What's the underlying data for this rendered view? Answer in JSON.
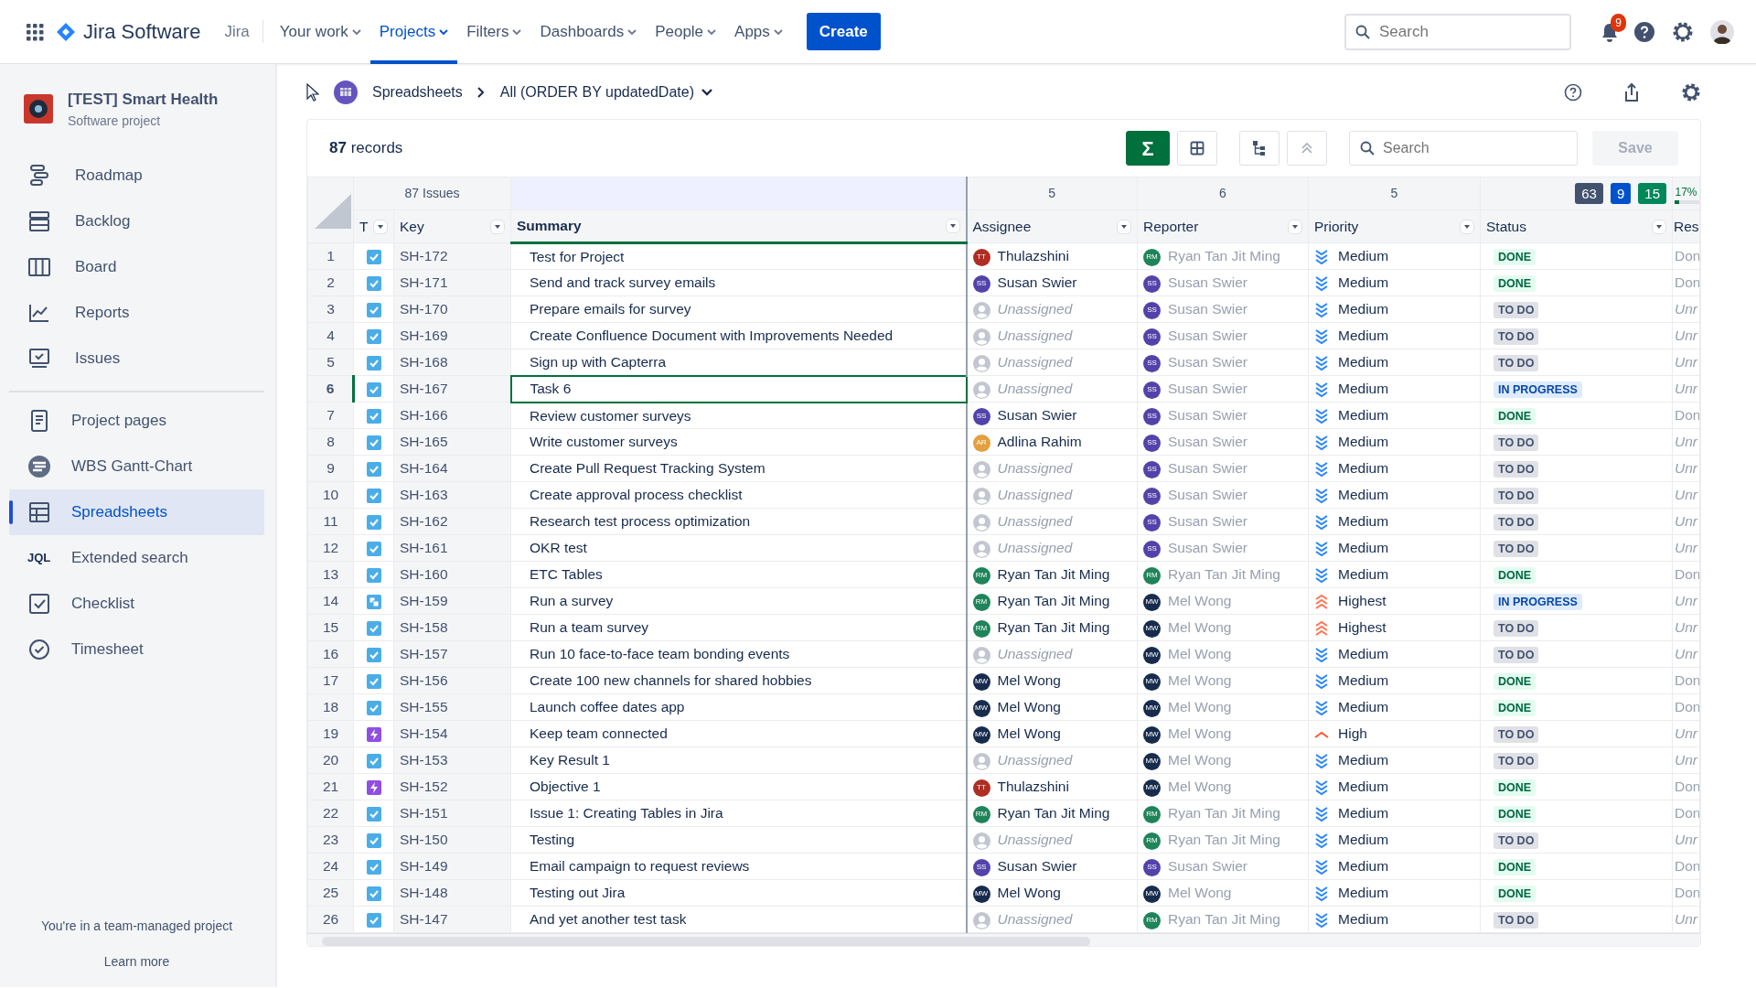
{
  "topnav": {
    "product": "Jira Software",
    "site": "Jira",
    "menus": [
      {
        "label": "Your work",
        "selected": false
      },
      {
        "label": "Projects",
        "selected": true
      },
      {
        "label": "Filters",
        "selected": false
      },
      {
        "label": "Dashboards",
        "selected": false
      },
      {
        "label": "People",
        "selected": false
      },
      {
        "label": "Apps",
        "selected": false
      }
    ],
    "create": "Create",
    "search_placeholder": "Search",
    "notifications": "9"
  },
  "sidebar": {
    "project": "[TEST] Smart Health",
    "project_type": "Software project",
    "planning_items": [
      {
        "label": "Roadmap",
        "kind": "roadmap",
        "selected": false
      },
      {
        "label": "Backlog",
        "kind": "backlog",
        "selected": false
      },
      {
        "label": "Board",
        "kind": "board",
        "selected": false
      },
      {
        "label": "Reports",
        "kind": "reports",
        "selected": false
      },
      {
        "label": "Issues",
        "kind": "issues",
        "selected": false
      }
    ],
    "app_items": [
      {
        "label": "Project pages",
        "kind": "pages",
        "selected": false
      },
      {
        "label": "WBS Gantt-Chart",
        "kind": "gantt",
        "selected": false
      },
      {
        "label": "Spreadsheets",
        "kind": "sheet",
        "selected": true
      },
      {
        "label": "Extended search",
        "kind": "jql",
        "glyph": "JQL",
        "selected": false
      },
      {
        "label": "Checklist",
        "kind": "checklist",
        "selected": false
      },
      {
        "label": "Timesheet",
        "kind": "timesheet",
        "selected": false
      }
    ],
    "footer": "You're in a team-managed project",
    "footer_link": "Learn more"
  },
  "breadcrumb": {
    "parent": "Spreadsheets",
    "view": "All (ORDER BY updatedDate)"
  },
  "sheet": {
    "records_count": "87",
    "records_label": "records",
    "sum_button": "Σ",
    "search_placeholder": "Search",
    "save": "Save",
    "summary_row": {
      "issues": "87 Issues",
      "assignee": "5",
      "reporter": "6",
      "priority": "5",
      "status_counts": [
        {
          "count": "63",
          "color": "#42526e"
        },
        {
          "count": "9",
          "color": "#0052cc"
        },
        {
          "count": "15",
          "color": "#00875a"
        }
      ],
      "progress": {
        "reading": "17%",
        "level": 0.17
      }
    },
    "columns": [
      "T",
      "Key",
      "Summary",
      "Assignee",
      "Reporter",
      "Priority",
      "Status",
      "Res"
    ],
    "rows": [
      {
        "n": "1",
        "kind": "task",
        "key": "SH-172",
        "summary": "Test for Project",
        "assignee": {
          "kind": "user",
          "name": "Thulazshini",
          "initials": "TT",
          "color": "#ae2e24"
        },
        "reporter": {
          "kind": "user",
          "name": "Ryan Tan Jit Ming",
          "initials": "RM",
          "color": "#1f845a"
        },
        "priority": {
          "label": "Medium",
          "kind": "medium"
        },
        "status": {
          "label": "DONE",
          "kind": "done"
        },
        "resolution": "Don",
        "selected": false
      },
      {
        "n": "2",
        "kind": "task",
        "key": "SH-171",
        "summary": "Send and track survey emails",
        "assignee": {
          "kind": "user",
          "name": "Susan Swier",
          "initials": "SS",
          "color": "#5243aa"
        },
        "reporter": {
          "kind": "user",
          "name": "Susan Swier",
          "initials": "SS",
          "color": "#5243aa"
        },
        "priority": {
          "label": "Medium",
          "kind": "medium"
        },
        "status": {
          "label": "DONE",
          "kind": "done"
        },
        "resolution": "Don",
        "selected": false
      },
      {
        "n": "3",
        "kind": "task",
        "key": "SH-170",
        "summary": "Prepare emails for survey",
        "assignee": {
          "kind": "unassigned",
          "name": "Unassigned"
        },
        "reporter": {
          "kind": "user",
          "name": "Susan Swier",
          "initials": "SS",
          "color": "#5243aa"
        },
        "priority": {
          "label": "Medium",
          "kind": "medium"
        },
        "status": {
          "label": "TO DO",
          "kind": "todo"
        },
        "resolution": "Unr",
        "selected": false
      },
      {
        "n": "4",
        "kind": "task",
        "key": "SH-169",
        "summary": "Create Confluence Document with Improvements Needed",
        "assignee": {
          "kind": "unassigned",
          "name": "Unassigned"
        },
        "reporter": {
          "kind": "user",
          "name": "Susan Swier",
          "initials": "SS",
          "color": "#5243aa"
        },
        "priority": {
          "label": "Medium",
          "kind": "medium"
        },
        "status": {
          "label": "TO DO",
          "kind": "todo"
        },
        "resolution": "Unr",
        "selected": false
      },
      {
        "n": "5",
        "kind": "task",
        "key": "SH-168",
        "summary": "Sign up with Capterra",
        "assignee": {
          "kind": "unassigned",
          "name": "Unassigned"
        },
        "reporter": {
          "kind": "user",
          "name": "Susan Swier",
          "initials": "SS",
          "color": "#5243aa"
        },
        "priority": {
          "label": "Medium",
          "kind": "medium"
        },
        "status": {
          "label": "TO DO",
          "kind": "todo"
        },
        "resolution": "Unr",
        "selected": false
      },
      {
        "n": "6",
        "kind": "task",
        "key": "SH-167",
        "summary": "Task 6",
        "assignee": {
          "kind": "unassigned",
          "name": "Unassigned"
        },
        "reporter": {
          "kind": "user",
          "name": "Susan Swier",
          "initials": "SS",
          "color": "#5243aa"
        },
        "priority": {
          "label": "Medium",
          "kind": "medium"
        },
        "status": {
          "label": "IN PROGRESS",
          "kind": "progress"
        },
        "resolution": "Unr",
        "selected": true
      },
      {
        "n": "7",
        "kind": "task",
        "key": "SH-166",
        "summary": "Review customer surveys",
        "assignee": {
          "kind": "user",
          "name": "Susan Swier",
          "initials": "SS",
          "color": "#5243aa"
        },
        "reporter": {
          "kind": "user",
          "name": "Susan Swier",
          "initials": "SS",
          "color": "#5243aa"
        },
        "priority": {
          "label": "Medium",
          "kind": "medium"
        },
        "status": {
          "label": "DONE",
          "kind": "done"
        },
        "resolution": "Don",
        "selected": false
      },
      {
        "n": "8",
        "kind": "task",
        "key": "SH-165",
        "summary": "Write customer surveys",
        "assignee": {
          "kind": "user",
          "name": "Adlina Rahim",
          "initials": "AR",
          "color": "#e2a03f"
        },
        "reporter": {
          "kind": "user",
          "name": "Susan Swier",
          "initials": "SS",
          "color": "#5243aa"
        },
        "priority": {
          "label": "Medium",
          "kind": "medium"
        },
        "status": {
          "label": "TO DO",
          "kind": "todo"
        },
        "resolution": "Unr",
        "selected": false
      },
      {
        "n": "9",
        "kind": "task",
        "key": "SH-164",
        "summary": "Create Pull Request Tracking System",
        "assignee": {
          "kind": "unassigned",
          "name": "Unassigned"
        },
        "reporter": {
          "kind": "user",
          "name": "Susan Swier",
          "initials": "SS",
          "color": "#5243aa"
        },
        "priority": {
          "label": "Medium",
          "kind": "medium"
        },
        "status": {
          "label": "TO DO",
          "kind": "todo"
        },
        "resolution": "Unr",
        "selected": false
      },
      {
        "n": "10",
        "kind": "task",
        "key": "SH-163",
        "summary": "Create approval process checklist",
        "assignee": {
          "kind": "unassigned",
          "name": "Unassigned"
        },
        "reporter": {
          "kind": "user",
          "name": "Susan Swier",
          "initials": "SS",
          "color": "#5243aa"
        },
        "priority": {
          "label": "Medium",
          "kind": "medium"
        },
        "status": {
          "label": "TO DO",
          "kind": "todo"
        },
        "resolution": "Unr",
        "selected": false
      },
      {
        "n": "11",
        "kind": "task",
        "key": "SH-162",
        "summary": "Research test process optimization",
        "assignee": {
          "kind": "unassigned",
          "name": "Unassigned"
        },
        "reporter": {
          "kind": "user",
          "name": "Susan Swier",
          "initials": "SS",
          "color": "#5243aa"
        },
        "priority": {
          "label": "Medium",
          "kind": "medium"
        },
        "status": {
          "label": "TO DO",
          "kind": "todo"
        },
        "resolution": "Unr",
        "selected": false
      },
      {
        "n": "12",
        "kind": "task",
        "key": "SH-161",
        "summary": "OKR test",
        "assignee": {
          "kind": "unassigned",
          "name": "Unassigned"
        },
        "reporter": {
          "kind": "user",
          "name": "Susan Swier",
          "initials": "SS",
          "color": "#5243aa"
        },
        "priority": {
          "label": "Medium",
          "kind": "medium"
        },
        "status": {
          "label": "TO DO",
          "kind": "todo"
        },
        "resolution": "Unr",
        "selected": false
      },
      {
        "n": "13",
        "kind": "task",
        "key": "SH-160",
        "summary": "ETC Tables",
        "assignee": {
          "kind": "user",
          "name": "Ryan Tan Jit Ming",
          "initials": "RM",
          "color": "#1f845a"
        },
        "reporter": {
          "kind": "user",
          "name": "Ryan Tan Jit Ming",
          "initials": "RM",
          "color": "#1f845a"
        },
        "priority": {
          "label": "Medium",
          "kind": "medium"
        },
        "status": {
          "label": "DONE",
          "kind": "done"
        },
        "resolution": "Don",
        "selected": false
      },
      {
        "n": "14",
        "kind": "subtask",
        "key": "SH-159",
        "summary": "Run a survey",
        "assignee": {
          "kind": "user",
          "name": "Ryan Tan Jit Ming",
          "initials": "RM",
          "color": "#1f845a"
        },
        "reporter": {
          "kind": "user",
          "name": "Mel Wong",
          "initials": "MW",
          "color": "#172b4d"
        },
        "priority": {
          "label": "Highest",
          "kind": "highest"
        },
        "status": {
          "label": "IN PROGRESS",
          "kind": "progress"
        },
        "resolution": "Unr",
        "selected": false
      },
      {
        "n": "15",
        "kind": "task",
        "key": "SH-158",
        "summary": "Run a team survey",
        "assignee": {
          "kind": "user",
          "name": "Ryan Tan Jit Ming",
          "initials": "RM",
          "color": "#1f845a"
        },
        "reporter": {
          "kind": "user",
          "name": "Mel Wong",
          "initials": "MW",
          "color": "#172b4d"
        },
        "priority": {
          "label": "Highest",
          "kind": "highest"
        },
        "status": {
          "label": "TO DO",
          "kind": "todo"
        },
        "resolution": "Unr",
        "selected": false
      },
      {
        "n": "16",
        "kind": "task",
        "key": "SH-157",
        "summary": "Run 10 face-to-face team bonding events",
        "assignee": {
          "kind": "unassigned",
          "name": "Unassigned"
        },
        "reporter": {
          "kind": "user",
          "name": "Mel Wong",
          "initials": "MW",
          "color": "#172b4d"
        },
        "priority": {
          "label": "Medium",
          "kind": "medium"
        },
        "status": {
          "label": "TO DO",
          "kind": "todo"
        },
        "resolution": "Unr",
        "selected": false
      },
      {
        "n": "17",
        "kind": "task",
        "key": "SH-156",
        "summary": "Create 100 new channels for shared hobbies",
        "assignee": {
          "kind": "user",
          "name": "Mel Wong",
          "initials": "MW",
          "color": "#172b4d"
        },
        "reporter": {
          "kind": "user",
          "name": "Mel Wong",
          "initials": "MW",
          "color": "#172b4d"
        },
        "priority": {
          "label": "Medium",
          "kind": "medium"
        },
        "status": {
          "label": "DONE",
          "kind": "done"
        },
        "resolution": "Don",
        "selected": false
      },
      {
        "n": "18",
        "kind": "task",
        "key": "SH-155",
        "summary": "Launch coffee dates app",
        "assignee": {
          "kind": "user",
          "name": "Mel Wong",
          "initials": "MW",
          "color": "#172b4d"
        },
        "reporter": {
          "kind": "user",
          "name": "Mel Wong",
          "initials": "MW",
          "color": "#172b4d"
        },
        "priority": {
          "label": "Medium",
          "kind": "medium"
        },
        "status": {
          "label": "DONE",
          "kind": "done"
        },
        "resolution": "Don",
        "selected": false
      },
      {
        "n": "19",
        "kind": "epic",
        "key": "SH-154",
        "summary": "Keep team connected",
        "assignee": {
          "kind": "user",
          "name": "Mel Wong",
          "initials": "MW",
          "color": "#172b4d"
        },
        "reporter": {
          "kind": "user",
          "name": "Mel Wong",
          "initials": "MW",
          "color": "#172b4d"
        },
        "priority": {
          "label": "High",
          "kind": "high"
        },
        "status": {
          "label": "TO DO",
          "kind": "todo"
        },
        "resolution": "Unr",
        "selected": false
      },
      {
        "n": "20",
        "kind": "task",
        "key": "SH-153",
        "summary": "Key Result 1",
        "assignee": {
          "kind": "unassigned",
          "name": "Unassigned"
        },
        "reporter": {
          "kind": "user",
          "name": "Mel Wong",
          "initials": "MW",
          "color": "#172b4d"
        },
        "priority": {
          "label": "Medium",
          "kind": "medium"
        },
        "status": {
          "label": "TO DO",
          "kind": "todo"
        },
        "resolution": "Unr",
        "selected": false
      },
      {
        "n": "21",
        "kind": "epic",
        "key": "SH-152",
        "summary": "Objective 1",
        "assignee": {
          "kind": "user",
          "name": "Thulazshini",
          "initials": "TT",
          "color": "#ae2e24"
        },
        "reporter": {
          "kind": "user",
          "name": "Mel Wong",
          "initials": "MW",
          "color": "#172b4d"
        },
        "priority": {
          "label": "Medium",
          "kind": "medium"
        },
        "status": {
          "label": "DONE",
          "kind": "done"
        },
        "resolution": "Don",
        "selected": false
      },
      {
        "n": "22",
        "kind": "task",
        "key": "SH-151",
        "summary": "Issue 1: Creating Tables in Jira",
        "assignee": {
          "kind": "user",
          "name": "Ryan Tan Jit Ming",
          "initials": "RM",
          "color": "#1f845a"
        },
        "reporter": {
          "kind": "user",
          "name": "Ryan Tan Jit Ming",
          "initials": "RM",
          "color": "#1f845a"
        },
        "priority": {
          "label": "Medium",
          "kind": "medium"
        },
        "status": {
          "label": "DONE",
          "kind": "done"
        },
        "resolution": "Don",
        "selected": false
      },
      {
        "n": "23",
        "kind": "task",
        "key": "SH-150",
        "summary": "Testing",
        "assignee": {
          "kind": "unassigned",
          "name": "Unassigned"
        },
        "reporter": {
          "kind": "user",
          "name": "Ryan Tan Jit Ming",
          "initials": "RM",
          "color": "#1f845a"
        },
        "priority": {
          "label": "Medium",
          "kind": "medium"
        },
        "status": {
          "label": "TO DO",
          "kind": "todo"
        },
        "resolution": "Unr",
        "selected": false
      },
      {
        "n": "24",
        "kind": "task",
        "key": "SH-149",
        "summary": "Email campaign to request reviews",
        "assignee": {
          "kind": "user",
          "name": "Susan Swier",
          "initials": "SS",
          "color": "#5243aa"
        },
        "reporter": {
          "kind": "user",
          "name": "Susan Swier",
          "initials": "SS",
          "color": "#5243aa"
        },
        "priority": {
          "label": "Medium",
          "kind": "medium"
        },
        "status": {
          "label": "DONE",
          "kind": "done"
        },
        "resolution": "Don",
        "selected": false
      },
      {
        "n": "25",
        "kind": "task",
        "key": "SH-148",
        "summary": "Testing out Jira",
        "assignee": {
          "kind": "user",
          "name": "Mel Wong",
          "initials": "MW",
          "color": "#172b4d"
        },
        "reporter": {
          "kind": "user",
          "name": "Mel Wong",
          "initials": "MW",
          "color": "#172b4d"
        },
        "priority": {
          "label": "Medium",
          "kind": "medium"
        },
        "status": {
          "label": "DONE",
          "kind": "done"
        },
        "resolution": "Don",
        "selected": false
      },
      {
        "n": "26",
        "kind": "task",
        "key": "SH-147",
        "summary": "And yet another test task",
        "assignee": {
          "kind": "unassigned",
          "name": "Unassigned"
        },
        "reporter": {
          "kind": "user",
          "name": "Ryan Tan Jit Ming",
          "initials": "RM",
          "color": "#1f845a"
        },
        "priority": {
          "label": "Medium",
          "kind": "medium"
        },
        "status": {
          "label": "TO DO",
          "kind": "todo"
        },
        "resolution": "Unr",
        "selected": false
      }
    ]
  }
}
